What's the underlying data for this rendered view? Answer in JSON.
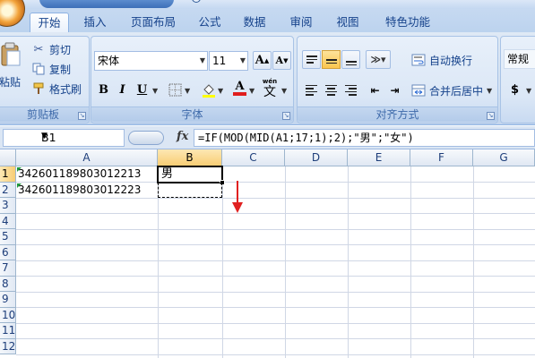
{
  "ribbon": {
    "tabs": [
      {
        "label": "开始",
        "active": true
      },
      {
        "label": "插入"
      },
      {
        "label": "页面布局"
      },
      {
        "label": "公式"
      },
      {
        "label": "数据"
      },
      {
        "label": "审阅"
      },
      {
        "label": "视图"
      },
      {
        "label": "特色功能"
      }
    ],
    "clipboard": {
      "paste_label": "粘贴",
      "cut_label": "剪切",
      "copy_label": "复制",
      "format_painter_label": "格式刷",
      "group_label": "剪贴板"
    },
    "font": {
      "font_name": "宋体",
      "font_size": "11",
      "grow_label": "A",
      "shrink_label": "A",
      "bold_label": "B",
      "italic_label": "I",
      "underline_label": "U",
      "phonetic_top": "wén",
      "phonetic_char": "文",
      "font_color_label": "A",
      "group_label": "字体"
    },
    "alignment": {
      "wrap_label": "自动换行",
      "merge_label": "合并后居中",
      "group_label": "对齐方式"
    },
    "number": {
      "format_label": "常规",
      "currency_label": "$"
    }
  },
  "formula_bar": {
    "name_box": "B1",
    "fx_label": "fx",
    "formula": "=IF(MOD(MID(A1;17;1);2);\"男\";\"女\")"
  },
  "sheet": {
    "columns": [
      "A",
      "B",
      "C",
      "D",
      "E",
      "F",
      "G"
    ],
    "active_column": "B",
    "active_cell": "B1",
    "rows": [
      "1",
      "2",
      "3",
      "4",
      "5",
      "6",
      "7",
      "8",
      "9",
      "10",
      "11",
      "12"
    ],
    "cells": {
      "A1": "342601189803012213",
      "A2": "342601189803012223",
      "B1": "男"
    }
  },
  "colors": {
    "accent": "#15428b",
    "selected_header": "#f8cd74",
    "annotation_arrow": "#e02020",
    "error_triangle": "#1f9b3d"
  }
}
